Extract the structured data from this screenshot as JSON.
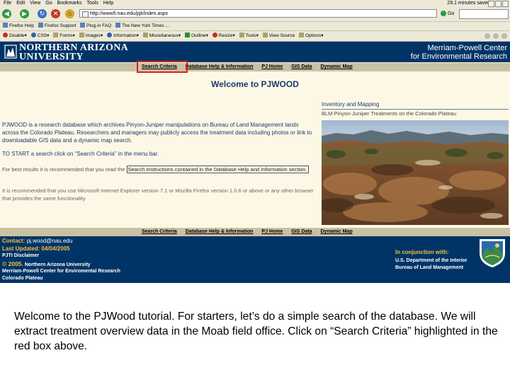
{
  "browser": {
    "menu": [
      "File",
      "Edit",
      "View",
      "Go",
      "Bookmarks",
      "Tools",
      "Help"
    ],
    "save_status": "29.1 minutes saved",
    "url": "http://www5.nau.edu/pjti/index.aspx",
    "go_label": "Go",
    "bookmarks": [
      "Firefox Help",
      "Firefox Support",
      "Plug-in FAQ",
      "The New York Times ..."
    ],
    "dev_toolbar": [
      "Disable▾",
      "CSS▾",
      "Forms▾",
      "Images▾",
      "Information▾",
      "Miscellaneous▾",
      "Outline▾",
      "Resize▾",
      "Tools▾",
      "View Source",
      "Options▾"
    ]
  },
  "header": {
    "university_line1": "NORTHERN ARIZONA",
    "university_line2": "UNIVERSITY",
    "center_line1": "Merriam-Powell Center",
    "center_line2": "for Environmental Research"
  },
  "nav": [
    "Search Criteria",
    "Database Help & Information",
    "PJ Home",
    "GIS Data",
    "Dynamic Map"
  ],
  "main": {
    "title": "Welcome to PJWOOD",
    "intro": "PJWOOD is a research database which archives Pinyon-Juniper manipulations on Bureau of Land Management lands across the Colorado Plateau. Researchers and managers may publicly access the treatment data including photos or link to downloadable GIS data and a dynamic map search.",
    "start": "TO START a search click on \"Search Criteria\" in the menu bar.",
    "best_prefix": "For best results it is recommended that you read the ",
    "best_link": "Search Instructions contained in the Database Help and Information section.",
    "recommend": "It is recommended that you use Microsoft Internet Explorer version 7.1 or Mozilla Firefox version 1.0.6 or above or any other browser that provides the same functionality"
  },
  "side": {
    "title": "Inventory and Mapping",
    "subtitle": "BLM Pinyon-Juniper Treatments on the Colorado Plateau"
  },
  "footer": {
    "contact_label": "Contact:",
    "contact_email": "pj.wood@nau.edu",
    "updated_label": "Last Updated: 04/04/2005",
    "disclaimer": "PJTI Disclaimer",
    "copyright_symbol": "© 2005.",
    "copyright_text": "Northern Arizona University",
    "center": "Merriam-Powell Center for Enviromental Research",
    "plateau": "Colorado Plateau",
    "conjunction": "In conjunction with:",
    "doi_line1": "U.S. Department of the Interior",
    "doi_line2": "Bureau of Land Management"
  },
  "caption": "Welcome to the PJWood tutorial. For starters, let’s do a simple search of the database. We will extract treatment overview data in the Moab field office. Click on “Search Criteria” highlighted in the red box above.",
  "colors": {
    "header_blue": "#003466",
    "nav_bar": "#c9c1a3",
    "page_bg": "#fdf8e6",
    "highlight": "#e0201c",
    "gold": "#f0c040"
  }
}
